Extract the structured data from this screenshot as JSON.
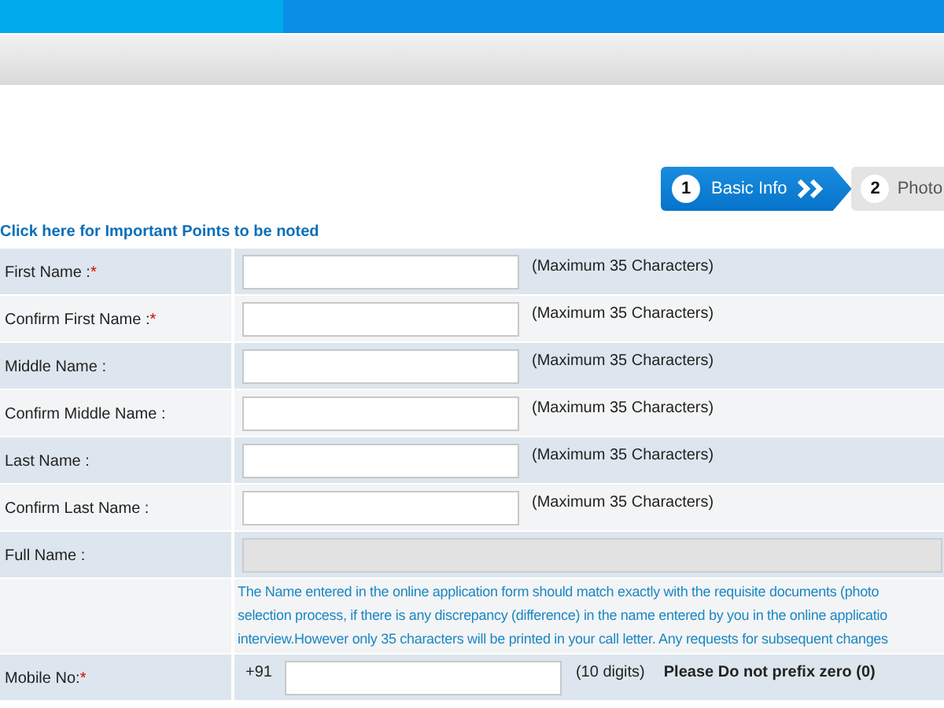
{
  "steps": [
    {
      "number": "1",
      "label": "Basic Info",
      "selected": true
    },
    {
      "number": "2",
      "label": "Photo",
      "selected": false
    }
  ],
  "notice_link": "Click here for Important Points to be noted",
  "fields": [
    {
      "label": "First Name :",
      "mark": "*",
      "kind": "text",
      "hint": "(Maximum 35 Characters)"
    },
    {
      "label": "Confirm First Name :",
      "mark": "*",
      "kind": "text",
      "hint": "(Maximum 35 Characters)"
    },
    {
      "label": "Middle Name :",
      "kind": "text",
      "hint": "(Maximum 35 Characters)"
    },
    {
      "label": "Confirm Middle Name :",
      "kind": "text",
      "hint": "(Maximum 35 Characters)"
    },
    {
      "label": "Last Name :",
      "kind": "text",
      "hint": "(Maximum 35 Characters)"
    },
    {
      "label": "Confirm Last Name :",
      "kind": "text",
      "hint": "(Maximum 35 Characters)"
    },
    {
      "label": "Full Name :",
      "kind": "readonly"
    },
    {
      "kind": "note",
      "lines": [
        "The Name entered in the online application form should match exactly with the requisite documents (photo",
        "selection process, if there is any discrepancy (difference) in the name entered by you in the online applicatio",
        "interview.However only 35 characters will be printed in your call letter. Any requests for subsequent changes"
      ]
    },
    {
      "label": "Mobile No:",
      "mark": "*",
      "kind": "phone",
      "prefix": "+91",
      "hint": "(10 digits)",
      "warning": "Please Do not prefix zero (0)"
    }
  ]
}
